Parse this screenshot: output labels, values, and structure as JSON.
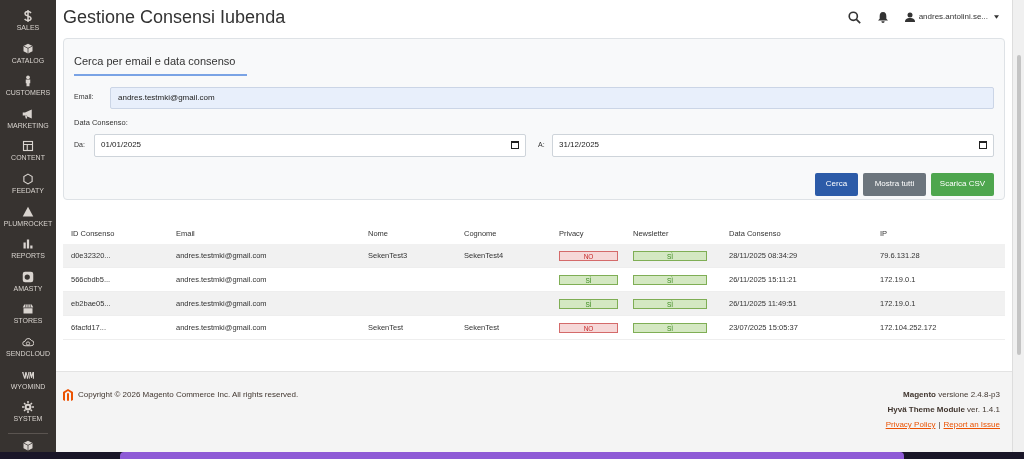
{
  "sidebar": {
    "items": [
      {
        "label": "SALES"
      },
      {
        "label": "CATALOG"
      },
      {
        "label": "CUSTOMERS"
      },
      {
        "label": "MARKETING"
      },
      {
        "label": "CONTENT"
      },
      {
        "label": "FEEDATY"
      },
      {
        "label": "PLUMROCKET"
      },
      {
        "label": "REPORTS"
      },
      {
        "label": "AMASTY"
      },
      {
        "label": "STORES"
      },
      {
        "label": "SENDCLOUD"
      },
      {
        "label": "WYOMIND"
      },
      {
        "label": "SYSTEM"
      }
    ]
  },
  "header": {
    "title": "Gestione Consensi Iubenda",
    "user": "andres.antolini.se..."
  },
  "search_panel": {
    "title": "Cerca per email e data consenso",
    "email": {
      "label": "Email:",
      "value": "andres.testmki@gmail.com"
    },
    "date_section": "Data Consenso:",
    "from": {
      "label": "Da:",
      "value": "01/01/2025"
    },
    "to": {
      "label": "A:",
      "value": "31/12/2025"
    },
    "buttons": [
      {
        "label": "Cerca",
        "kind": "primary"
      },
      {
        "label": "Mostra tutti",
        "kind": "secondary"
      },
      {
        "label": "Scarica CSV",
        "kind": "success"
      }
    ]
  },
  "table": {
    "columns": [
      "ID Consenso",
      "Email",
      "Nome",
      "Cognome",
      "Privacy",
      "Newsletter",
      "Data Consenso",
      "IP"
    ],
    "rows": [
      {
        "id": "d0e32320...",
        "email": "andres.testmki@gmail.com",
        "nome": "SekenTest3",
        "cognome": "SekenTest4",
        "privacy": {
          "label": "NO",
          "granted": false
        },
        "newsletter": {
          "label": "SÌ",
          "granted": true
        },
        "date": "28/11/2025 08:34:29",
        "ip": "79.6.131.28"
      },
      {
        "id": "566cbdb5...",
        "email": "andres.testmki@gmail.com",
        "privacy": {
          "label": "SÌ",
          "granted": true
        },
        "newsletter": {
          "label": "SÌ",
          "granted": true
        },
        "date": "26/11/2025 15:11:21",
        "ip": "172.19.0.1"
      },
      {
        "id": "eb2bae05...",
        "email": "andres.testmki@gmail.com",
        "privacy": {
          "label": "SÌ",
          "granted": true
        },
        "newsletter": {
          "label": "SÌ",
          "granted": true
        },
        "date": "26/11/2025 11:49:51",
        "ip": "172.19.0.1"
      },
      {
        "id": "6facfd17...",
        "email": "andres.testmki@gmail.com",
        "nome": "SekenTest",
        "cognome": "SekenTest",
        "privacy": {
          "label": "NO",
          "granted": false
        },
        "newsletter": {
          "label": "SÌ",
          "granted": true
        },
        "date": "23/07/2025 15:05:37",
        "ip": "172.104.252.172"
      }
    ]
  },
  "footer": {
    "copyright": "Copyright © 2026 Magento Commerce Inc. All rights reserved.",
    "version": "**Magento** versione 2.4.8-p3",
    "theme": "**Hyvä Theme Module** ver. 1.4.1",
    "links": [
      "Privacy Policy",
      "Report an Issue"
    ],
    "separator": "|"
  }
}
